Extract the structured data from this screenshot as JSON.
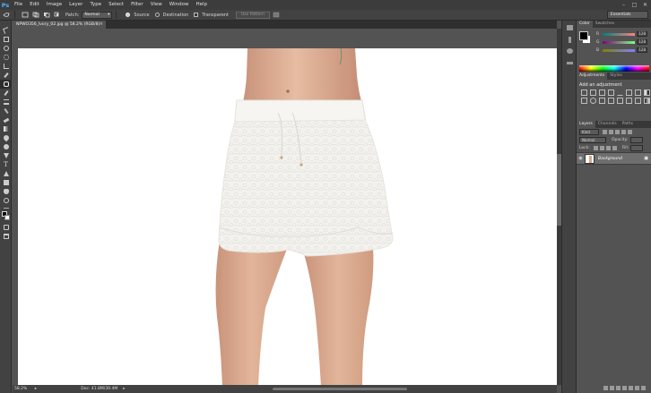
{
  "app": {
    "logo": "Ps",
    "menus": [
      "File",
      "Edit",
      "Image",
      "Layer",
      "Type",
      "Select",
      "Filter",
      "View",
      "Window",
      "Help"
    ],
    "window_controls": [
      "–",
      "□",
      "✕"
    ]
  },
  "options": {
    "patch_label": "Patch:",
    "patch_mode": "Normal",
    "source_label": "Source",
    "destination_label": "Destination",
    "transparent_label": "Transparent",
    "use_pattern_label": "Use Pattern",
    "workspace": "Essentials"
  },
  "document": {
    "tab_title": "NPWO356_Ivory_02.jpg @ 58.2% (RGB/8)",
    "close_glyph": "×"
  },
  "status": {
    "zoom": "58.2%",
    "doc_info": "Doc: 41.8M/39.4M"
  },
  "color_panel": {
    "tabs": [
      "Color",
      "Swatches"
    ],
    "r_label": "R",
    "g_label": "G",
    "b_label": "B",
    "r_value": "128",
    "g_value": "128",
    "b_value": "128"
  },
  "adjustments_panel": {
    "tabs": [
      "Adjustments",
      "Styles"
    ],
    "title": "Add an adjustment"
  },
  "layers_panel": {
    "tabs": [
      "Layers",
      "Channels",
      "Paths"
    ],
    "kind_label": "Kind",
    "blend_mode": "Normal",
    "opacity_label": "Opacity:",
    "lock_label": "Lock:",
    "fill_label": "Fill:",
    "layer_name": "Background"
  },
  "colors": {
    "canvas_bg": "#ffffff",
    "app_bg": "#535353",
    "skin": "#dcae92",
    "shorts": "#f4f3f0"
  }
}
